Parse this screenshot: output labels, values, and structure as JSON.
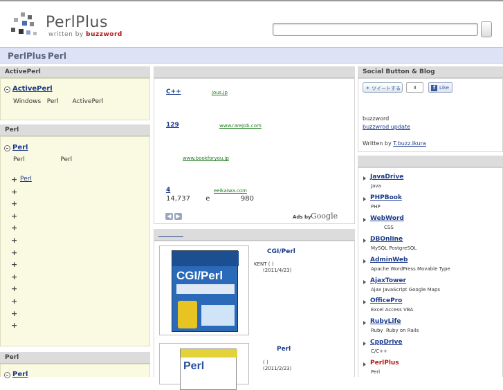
{
  "header": {
    "logo_title": "PerlPlus",
    "logo_sub_prefix": "written by",
    "logo_sub_author": "buzzword"
  },
  "nav": {
    "items": [
      "PerlPlus",
      "Perl"
    ]
  },
  "left": {
    "panel1": {
      "head": "ActivePerl",
      "title": "ActivePerl",
      "desc": "Windows   Perl       ActivePerl"
    },
    "panel2": {
      "head": "Perl",
      "title": "Perl",
      "desc": "Perl                  Perl",
      "links": [
        "Perl",
        "",
        "",
        "",
        "",
        "",
        "",
        "",
        "",
        "",
        "",
        "",
        "",
        ""
      ]
    },
    "panel3": {
      "head": "Perl",
      "title": "Perl"
    }
  },
  "middle": {
    "ads": [
      {
        "title": "C++",
        "url": "jous.jp"
      },
      {
        "title": "129",
        "url": "www.rarejob.com"
      },
      {
        "title": "",
        "url": "www.bookforyou.jp"
      },
      {
        "title": "4",
        "url": "eeikaiwa.com",
        "line2": "14,737       e              980"
      }
    ],
    "ads_by": "Ads by",
    "google": "Google",
    "books_head": "",
    "books": [
      {
        "title": "CGI/Perl",
        "line1": "KENT ( )",
        "line2": "(2011/4/23)"
      },
      {
        "title": "Perl",
        "line1": "( )",
        "line2": "(2011/2/23)"
      }
    ]
  },
  "right": {
    "social_head": "Social Button & Blog",
    "tweet_label": "ツイートする",
    "tweet_count": "3",
    "like_label": "Like",
    "blog_name": "buzzword",
    "blog_link": "buzzwrod update",
    "written_by": "Written by",
    "author_link": "T.buzz.Ikura",
    "links": [
      {
        "title": "JavaDrive",
        "desc": "Java"
      },
      {
        "title": "PHPBook",
        "desc": "PHP"
      },
      {
        "title": "WebWord",
        "desc": "CSS"
      },
      {
        "title": "DBOnline",
        "desc": "MySQL PostgreSQL"
      },
      {
        "title": "AdminWeb",
        "desc": "Apache WordPress Movable Type"
      },
      {
        "title": "AjaxTower",
        "desc": "Ajax JavaScript Google Maps"
      },
      {
        "title": "OfficePro",
        "desc": "Excel Access VBA"
      },
      {
        "title": "RubyLife",
        "desc": "Ruby  Ruby on Rails"
      },
      {
        "title": "CppDrive",
        "desc": "C/C++"
      },
      {
        "title": "PerlPlus",
        "desc": "Perl"
      }
    ]
  },
  "colors": {
    "link": "#1a3a8a",
    "brand_red": "#b01818",
    "nav_bg": "#dde3f4",
    "panel_bg": "#fafae2"
  }
}
